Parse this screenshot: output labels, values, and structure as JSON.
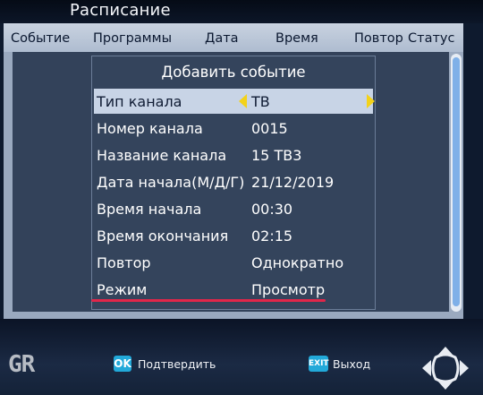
{
  "screen_title": "Расписание",
  "columns": [
    "Событие",
    "Программы",
    "Дата",
    "Время",
    "Повтор",
    "Статус"
  ],
  "dialog": {
    "title": "Добавить событие",
    "rows": [
      {
        "label": "Тип канала",
        "value": "ТВ"
      },
      {
        "label": "Номер канала",
        "value": "0015"
      },
      {
        "label": "Название канала",
        "value": "15 ТВ3"
      },
      {
        "label": "Дата начала(М/Д/Г)",
        "value": "21/12/2019"
      },
      {
        "label": "Время начала",
        "value": "00:30"
      },
      {
        "label": "Время окончания",
        "value": "02:15"
      },
      {
        "label": "Повтор",
        "value": "Однократно"
      },
      {
        "label": "Режим",
        "value": "Просмотр"
      }
    ]
  },
  "footer": {
    "logo": "GR",
    "ok_key": "OK",
    "ok_label": "Подтвердить",
    "exit_key": "EXIT",
    "exit_label": "Выход"
  },
  "colors": {
    "highlight": "#c8d4e6",
    "arrow": "#f3d21a",
    "underline": "#e1264a",
    "key_button": "#22a9d9"
  },
  "icons": [
    "arrow-left-icon",
    "arrow-right-icon",
    "navigation-pad-icon"
  ]
}
